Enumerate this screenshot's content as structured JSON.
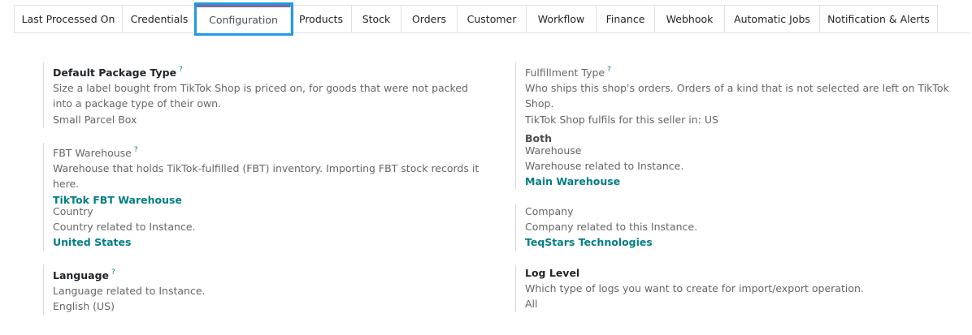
{
  "tabs": [
    {
      "label": "Last Processed On",
      "active": false
    },
    {
      "label": "Credentials",
      "active": false
    },
    {
      "label": "Configuration",
      "active": true
    },
    {
      "label": "Products",
      "active": false
    },
    {
      "label": "Stock",
      "active": false
    },
    {
      "label": "Orders",
      "active": false
    },
    {
      "label": "Customer",
      "active": false
    },
    {
      "label": "Workflow",
      "active": false
    },
    {
      "label": "Finance",
      "active": false
    },
    {
      "label": "Webhook",
      "active": false
    },
    {
      "label": "Automatic Jobs",
      "active": false
    },
    {
      "label": "Notification & Alerts",
      "active": false
    }
  ],
  "fields": {
    "default_package_type": {
      "label": "Default Package Type",
      "tooltip": "?",
      "help": "Size a label bought from TikTok Shop is priced on, for goods that were not packed into a package type of their own.",
      "value": "Small Parcel Box"
    },
    "fulfillment_type": {
      "label": "Fulfillment Type",
      "tooltip": "?",
      "help_line1": "Who ships this shop's orders. Orders of a kind that is not selected are left on TikTok Shop.",
      "help_line2": "TikTok Shop fulfils for this seller in: US",
      "value": "Both"
    },
    "fbt_warehouse": {
      "label": "FBT Warehouse",
      "tooltip": "?",
      "help": "Warehouse that holds TikTok-fulfilled (FBT) inventory. Importing FBT stock records it here.",
      "value": "TikTok FBT Warehouse"
    },
    "warehouse": {
      "label": "Warehouse",
      "help": "Warehouse related to Instance.",
      "value": "Main Warehouse"
    },
    "country": {
      "label": "Country",
      "help": "Country related to Instance.",
      "value": "United States"
    },
    "company": {
      "label": "Company",
      "help": "Company related to this Instance.",
      "value": "TeqStars Technologies"
    },
    "language": {
      "label": "Language",
      "tooltip": "?",
      "help": "Language related to Instance.",
      "value": "English (US)"
    },
    "log_level": {
      "label": "Log Level",
      "help": "Which type of logs you want to create for import/export operation.",
      "value": "All"
    }
  },
  "colors": {
    "link": "#017e84",
    "active_tab_highlight": "#1e9ae6",
    "active_tab_top": "#7c6b91",
    "border": "#dee2e6"
  }
}
